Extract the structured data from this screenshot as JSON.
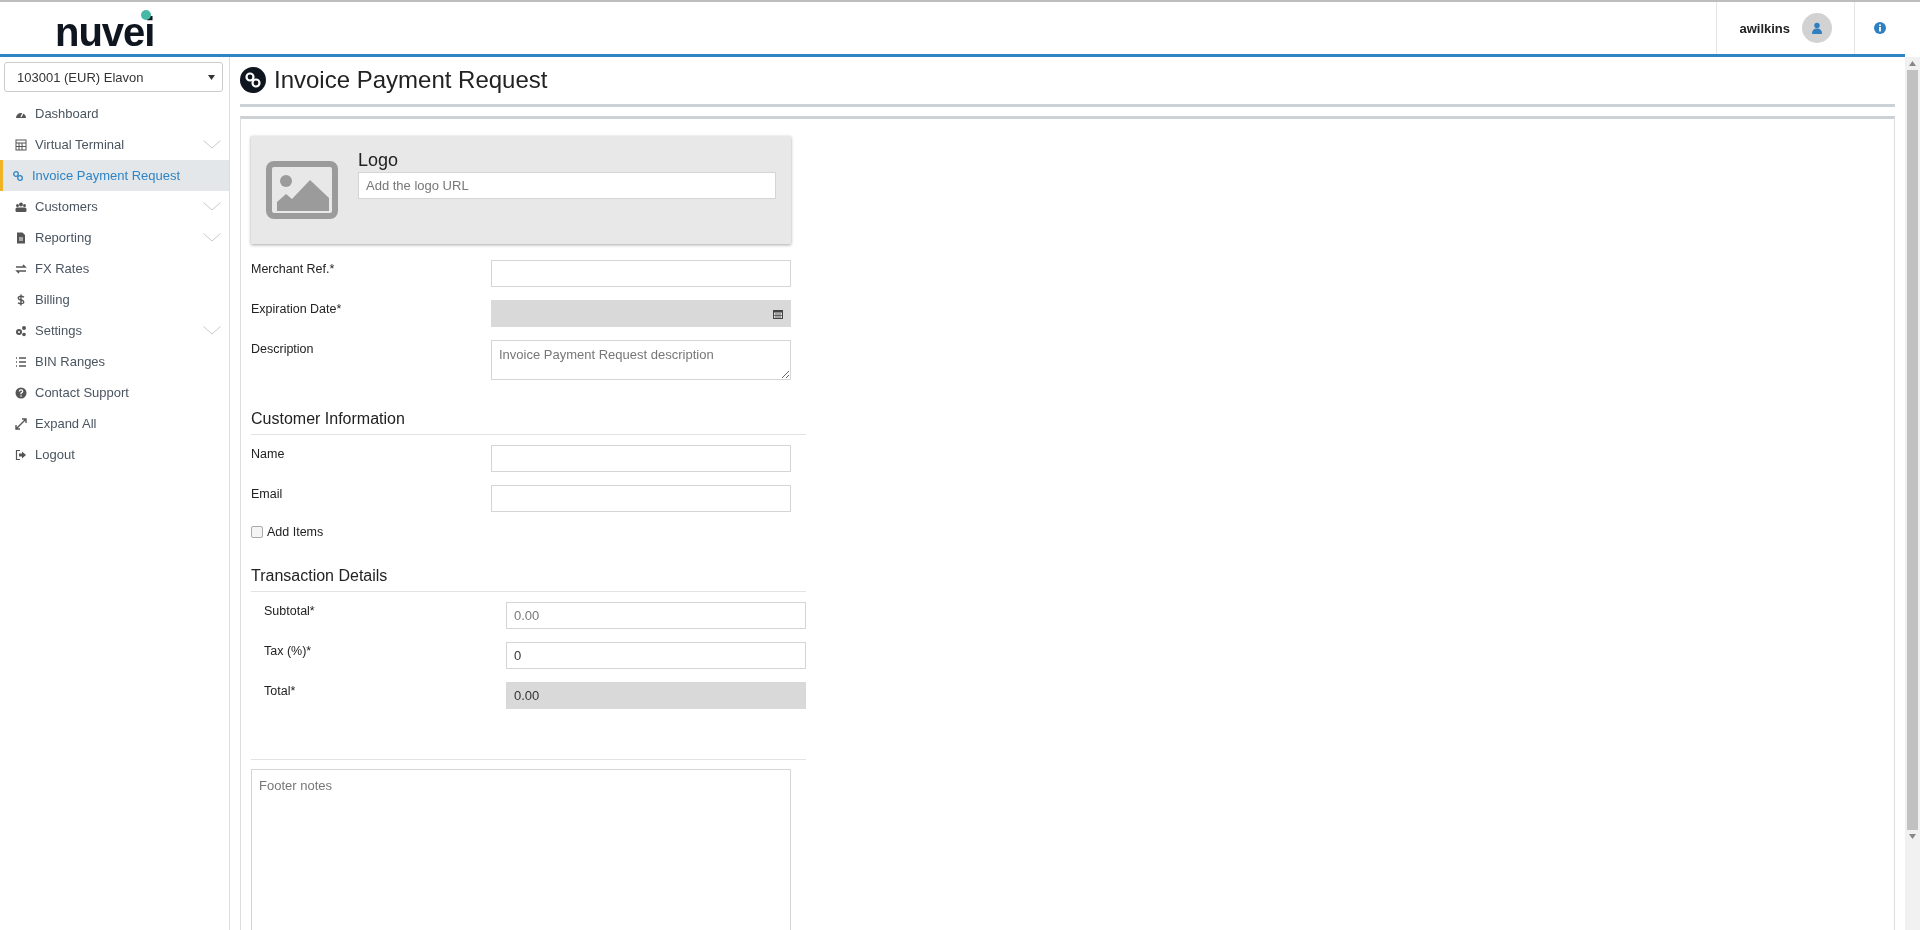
{
  "header": {
    "logo": "nuvei",
    "username": "awilkins"
  },
  "sidebar": {
    "account_select": "103001 (EUR) Elavon",
    "items": [
      {
        "label": "Dashboard",
        "selected": false,
        "collapsible": false
      },
      {
        "label": "Virtual Terminal",
        "selected": false,
        "collapsible": true
      },
      {
        "label": "Invoice Payment Request",
        "selected": true,
        "collapsible": false
      },
      {
        "label": "Customers",
        "selected": false,
        "collapsible": true
      },
      {
        "label": "Reporting",
        "selected": false,
        "collapsible": true
      },
      {
        "label": "FX Rates",
        "selected": false,
        "collapsible": false
      },
      {
        "label": "Billing",
        "selected": false,
        "collapsible": false
      },
      {
        "label": "Settings",
        "selected": false,
        "collapsible": true
      },
      {
        "label": "BIN Ranges",
        "selected": false,
        "collapsible": false
      },
      {
        "label": "Contact Support",
        "selected": false,
        "collapsible": false
      },
      {
        "label": "Expand All",
        "selected": false,
        "collapsible": false
      },
      {
        "label": "Logout",
        "selected": false,
        "collapsible": false
      }
    ]
  },
  "page": {
    "title": "Invoice Payment Request",
    "logo_card": {
      "title": "Logo",
      "placeholder": "Add the logo URL"
    },
    "fields": [
      {
        "kind": "text",
        "label": "Merchant Ref.*",
        "disabled": false
      },
      {
        "kind": "date",
        "label": "Expiration Date*",
        "disabled": true
      },
      {
        "kind": "textarea",
        "label": "Description",
        "placeholder": "Invoice Payment Request description",
        "disabled": false
      }
    ],
    "customer_section": {
      "heading": "Customer Information",
      "fields": [
        {
          "kind": "text",
          "label": "Name",
          "disabled": false
        },
        {
          "kind": "text",
          "label": "Email",
          "disabled": false
        },
        {
          "kind": "checkbox",
          "label": "Add Items",
          "checked": false
        }
      ]
    },
    "transaction_section": {
      "heading": "Transaction Details",
      "fields": [
        {
          "kind": "text",
          "label": "Subtotal*",
          "placeholder": "0.00",
          "disabled": false
        },
        {
          "kind": "text",
          "label": "Tax (%)*",
          "value": "0",
          "disabled": false
        },
        {
          "kind": "text",
          "label": "Total*",
          "value": "0.00",
          "disabled": true
        }
      ]
    },
    "footer_notes": {
      "placeholder": "Footer notes"
    }
  }
}
